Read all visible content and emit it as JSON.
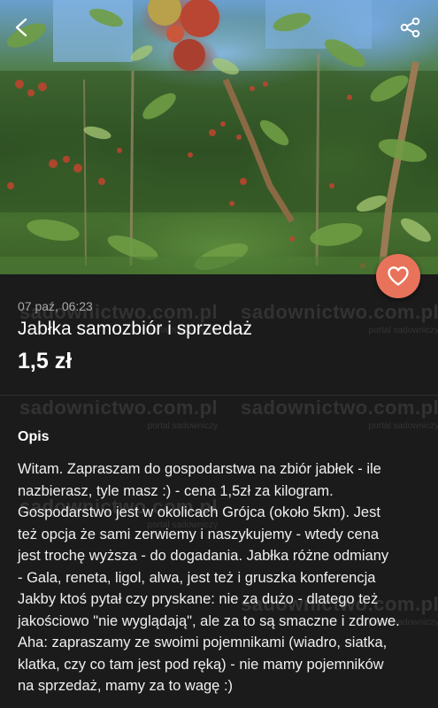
{
  "header": {
    "back_icon": "back-arrow-icon",
    "share_icon": "share-icon"
  },
  "favorite": {
    "icon": "heart-icon",
    "color": "#e8735a"
  },
  "listing": {
    "date": "07 paź, 06:23",
    "title": "Jabłka samozbiór i sprzedaż",
    "price": "1,5 zł"
  },
  "watermark": {
    "brand": "sadownictwo.com.pl",
    "tagline": "portal sadowniczy"
  },
  "description": {
    "heading": "Opis",
    "lines": [
      "Witam. Zapraszam do gospodarstwa na zbiór jabłek - ile",
      "nazbierasz, tyle masz :) - cena 1,5zł za kilogram.",
      "Gospodarstwo jest w okolicach Grójca (około 5km). Jest",
      "też opcja że sami zerwiemy i naszykujemy - wtedy cena",
      "jest trochę wyższa - do dogadania. Jabłka różne odmiany",
      "- Gala, reneta, ligol, alwa, jest też i gruszka konferencja",
      "Jakby ktoś pytał czy pryskane: nie za dużo - dlatego też",
      "jakościowo \"nie wyglądają\", ale za to są smaczne i zdrowe.",
      "Aha: zapraszamy ze swoimi pojemnikami (wiadro, siatka,",
      "klatka, czy co tam jest pod ręką) - nie mamy pojemników",
      "na sprzedaż, mamy za to wagę :)"
    ]
  }
}
